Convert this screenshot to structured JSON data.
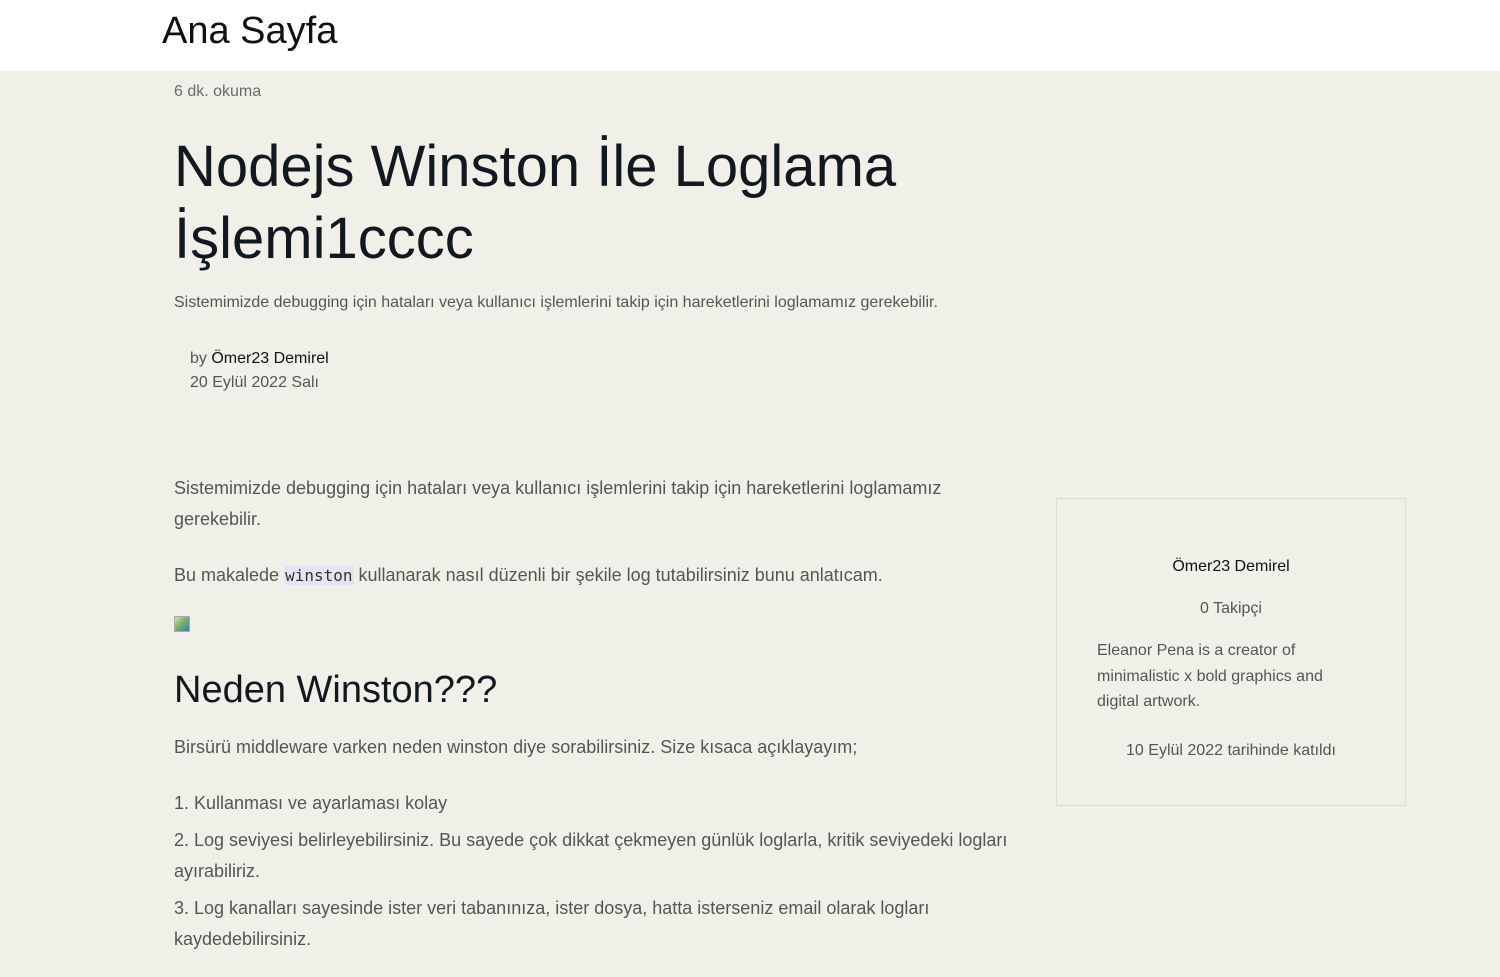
{
  "header": {
    "home_label": "Ana Sayfa"
  },
  "article": {
    "read_time": "6 dk. okuma",
    "title": "Nodejs Winston İle Loglama İşlemi1cccc",
    "subtitle": "Sistemimizde debugging için hataları veya kullanıcı işlemlerini takip için hareketlerini loglamamız gerekebilir.",
    "by_prefix": "by",
    "author_name": "Ömer23 Demirel",
    "date": "20 Eylül 2022 Salı"
  },
  "content": {
    "para1": "Sistemimizde debugging için hataları veya kullanıcı işlemlerini takip için hareketlerini loglamamız gerekebilir.",
    "para2_before": "Bu makalede ",
    "para2_code": "winston",
    "para2_after": " kullanarak nasıl düzenli bir şekile log tutabilirsiniz bunu anlatıcam.",
    "heading": "Neden Winston???",
    "para3": "Birsürü middleware varken neden winston diye sorabilirsiniz. Size kısaca açıklayayım;",
    "list": [
      "1. Kullanması ve ayarlaması kolay",
      "2. Log seviyesi belirleyebilirsiniz. Bu sayede çok dikkat çekmeyen günlük loglarla, kritik seviyedeki logları ayırabiliriz.",
      "3. Log kanalları sayesinde ister veri tabanınıza, ister dosya, hatta isterseniz email olarak logları kaydedebilirsiniz."
    ]
  },
  "author_card": {
    "name": "Ömer23 Demirel",
    "followers": "0 Takipçi",
    "bio": "Eleanor Pena is a creator of minimalistic x bold graphics and digital artwork.",
    "joined": "10 Eylül 2022 tarihinde katıldı"
  },
  "colors": {
    "page_background": "#f0f0e8",
    "header_background": "#ffffff",
    "heading_text": "#121820",
    "code_background": "#e3e6f2"
  }
}
